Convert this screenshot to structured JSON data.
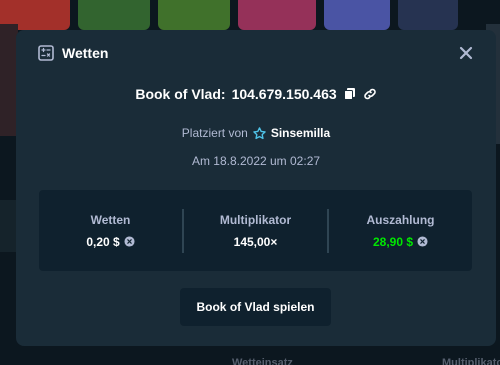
{
  "modal": {
    "title": "Wetten",
    "game": "Book of Vlad:",
    "bet_id": "104.679.150.463",
    "placed_label": "Platziert von",
    "username": "Sinsemilla",
    "date": "Am 18.8.2022 um 02:27",
    "stats": [
      {
        "label": "Wetten",
        "value": "0,20 $",
        "has_coin": true,
        "color": "white"
      },
      {
        "label": "Multiplikator",
        "value": "145,00×",
        "has_coin": false,
        "color": "white"
      },
      {
        "label": "Auszahlung",
        "value": "28,90 $",
        "has_coin": true,
        "color": "green"
      }
    ],
    "play_button": "Book of Vlad spielen"
  },
  "background": {
    "footer_labels": [
      "Wetteinsatz",
      "Multiplikator"
    ]
  },
  "colors": {
    "modal_bg": "#1a2c38",
    "stats_bg": "#0f212e",
    "muted_text": "#b1bad3",
    "payout_green": "#00e701"
  }
}
